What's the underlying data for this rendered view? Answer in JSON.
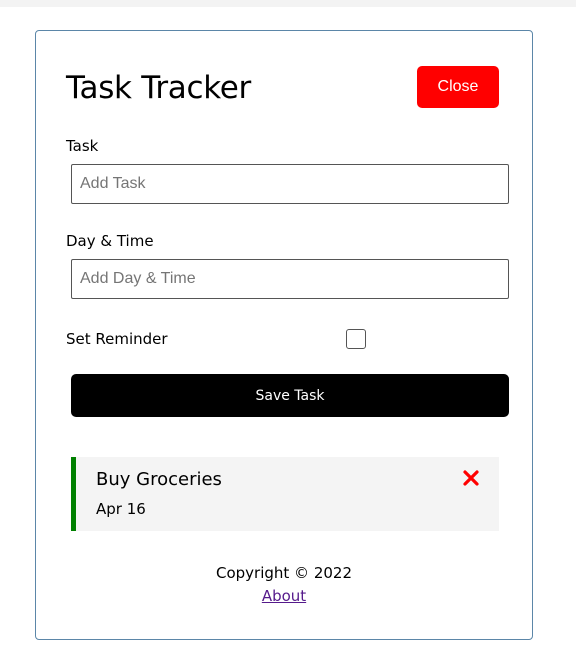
{
  "header": {
    "title": "Task Tracker",
    "close_label": "Close"
  },
  "form": {
    "task_label": "Task",
    "task_placeholder": "Add Task",
    "task_value": "",
    "day_label": "Day & Time",
    "day_placeholder": "Add Day & Time",
    "day_value": "",
    "reminder_label": "Set Reminder",
    "reminder_checked": false,
    "save_label": "Save Task"
  },
  "tasks": [
    {
      "title": "Buy Groceries",
      "date": "Apr 16",
      "reminder": true,
      "delete_icon": "close-x-icon"
    }
  ],
  "footer": {
    "copyright": "Copyright © 2022",
    "about_link": "About"
  },
  "colors": {
    "accent_close": "#ff0000",
    "reminder_border": "#008000",
    "save_button": "#000000",
    "link": "#551a8b"
  }
}
